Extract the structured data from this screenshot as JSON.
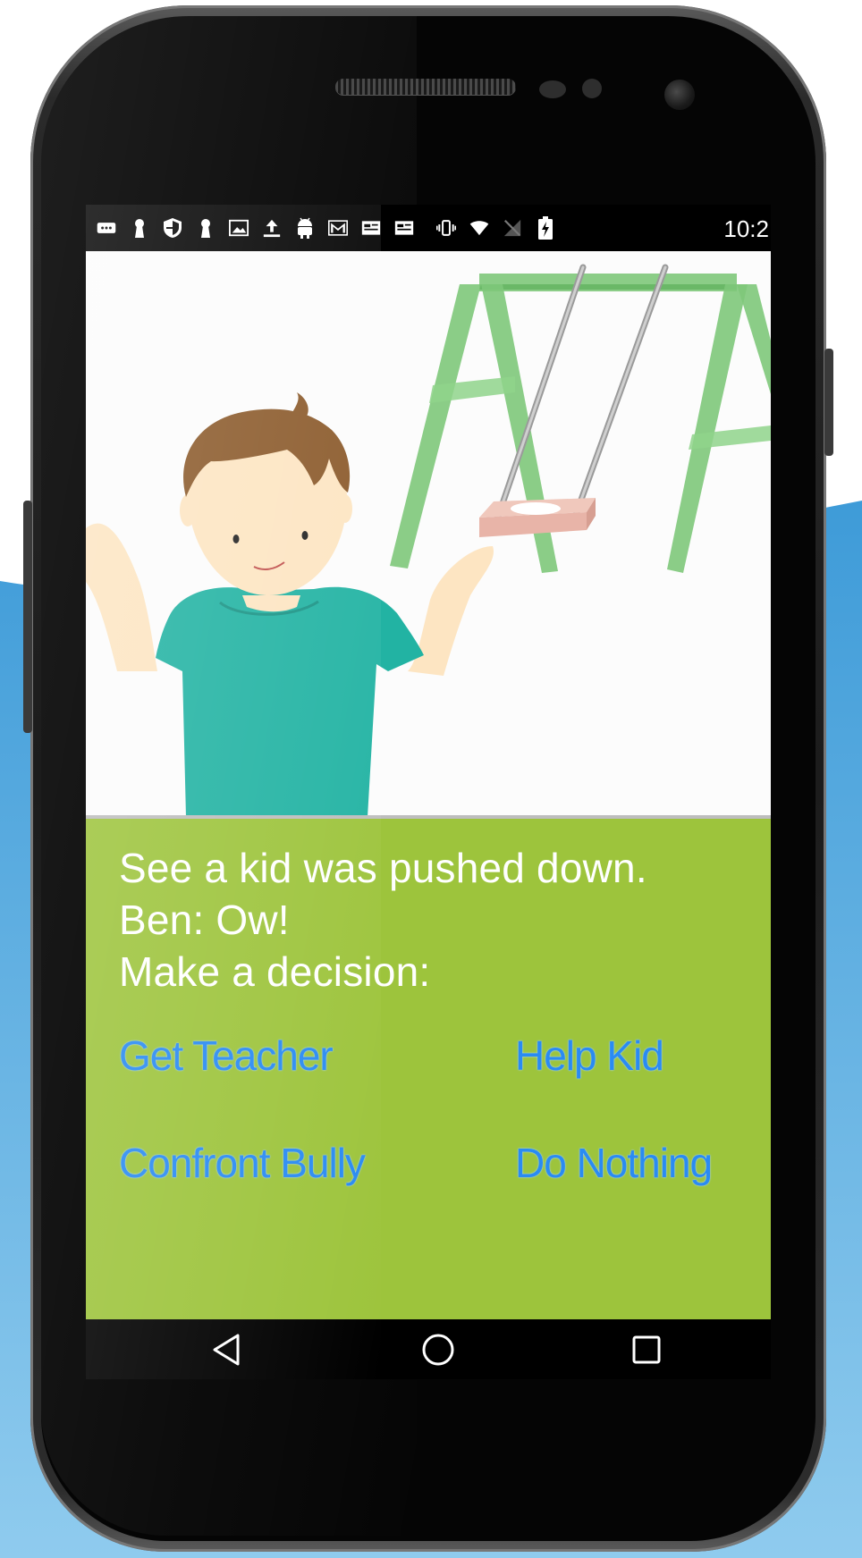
{
  "status_bar": {
    "time": "10:2",
    "icons": [
      "message-icon",
      "keyhole-icon",
      "shield-icon",
      "keyhole-icon",
      "image-icon",
      "upload-icon",
      "android-icon",
      "gmail-icon",
      "news-icon",
      "news-icon",
      "vibrate-icon",
      "wifi-icon",
      "no-signal-icon",
      "battery-charging-icon"
    ]
  },
  "story": {
    "line1": "See a kid was pushed down.",
    "line2": "Ben: Ow!",
    "line3": "Make a decision:"
  },
  "choices": {
    "get_teacher": "Get Teacher",
    "help_kid": "Help Kid",
    "confront_bully": "Confront Bully",
    "do_nothing": "Do Nothing"
  },
  "colors": {
    "panel": "#9dc43c",
    "choice_text": "#2a8bf2",
    "story_text": "#ffffff",
    "backdrop": "#4aa8e0"
  }
}
